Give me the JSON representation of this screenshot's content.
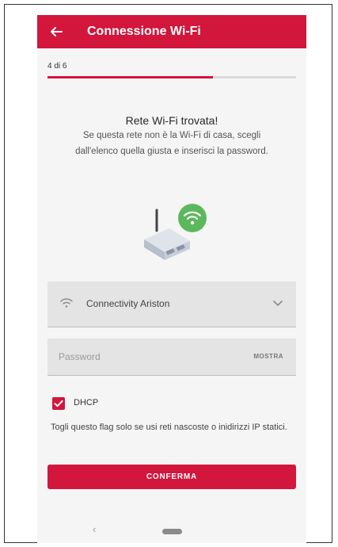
{
  "header": {
    "title": "Connessione Wi-Fi",
    "back_icon": "arrow-left-icon"
  },
  "progress": {
    "step_text": "4 di 6",
    "fraction": 0.667
  },
  "content": {
    "heading": "Rete Wi-Fi trovata!",
    "description": "Se questa rete non è la Wi-Fi di casa, scegli dall'elenco quella giusta e inserisci la password."
  },
  "network_select": {
    "selected": "Connectivity Ariston",
    "icon": "wifi-icon"
  },
  "password": {
    "placeholder": "Password",
    "value": "",
    "toggle_label": "MOSTRA"
  },
  "dhcp": {
    "label": "DHCP",
    "checked": true
  },
  "note": "Togli questo flag solo se usi reti nascoste o inidirizzi IP statici.",
  "confirm_label": "CONFERMA",
  "colors": {
    "accent": "#d2163c",
    "wifi_badge": "#5cb85c"
  }
}
